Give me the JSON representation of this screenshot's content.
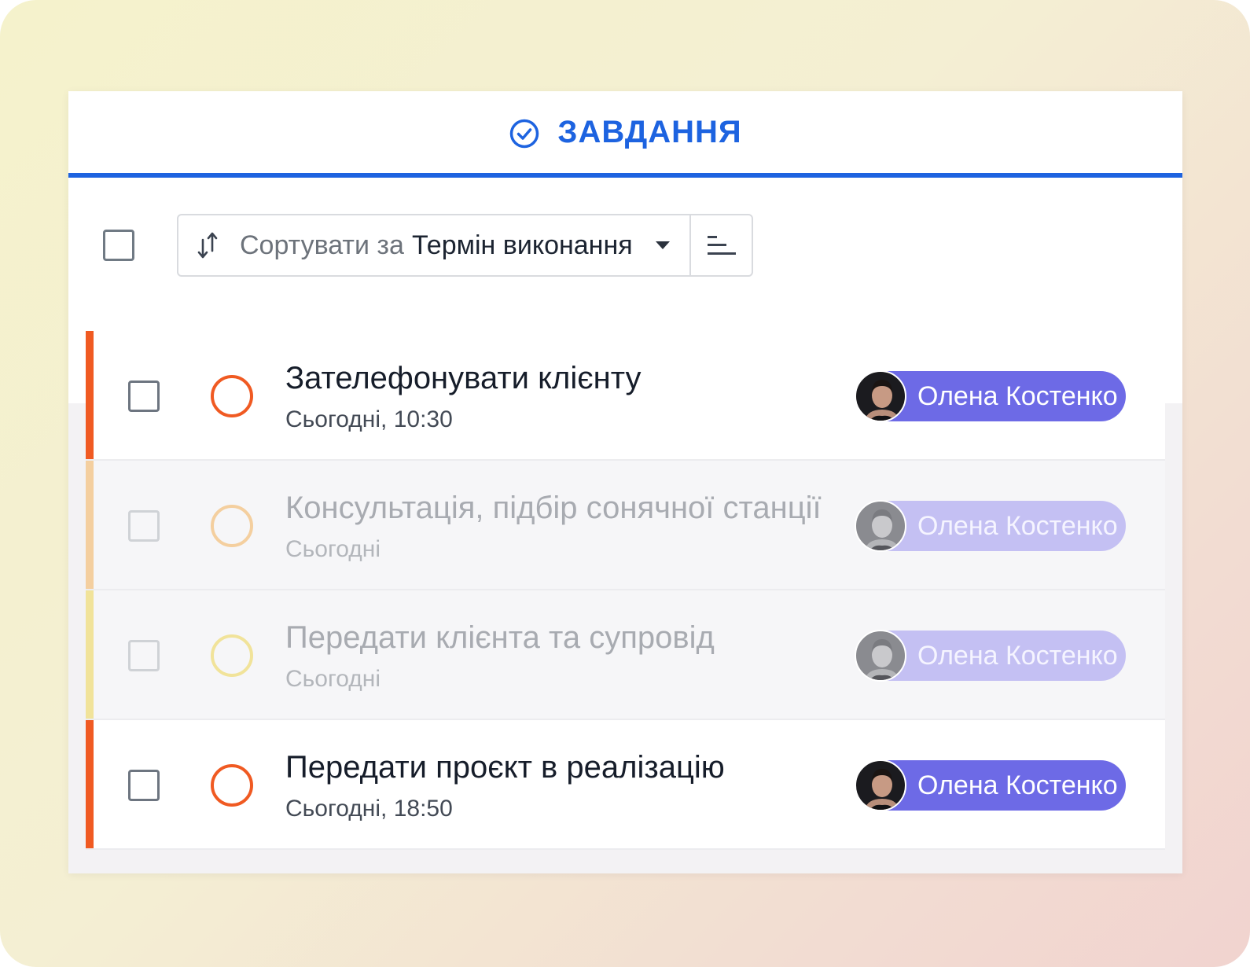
{
  "header": {
    "title": "ЗАВДАННЯ",
    "accent_color": "#1d63e0",
    "icon": "check-circle-icon"
  },
  "toolbar": {
    "sort_prefix": "Сортувати за",
    "sort_value": "Термін виконання",
    "sort_icon": "sort-arrows-icon",
    "dropdown_icon": "caret-down-icon",
    "order_icon": "sort-order-icon"
  },
  "tasks": [
    {
      "title": "Зателефонувати клієнту",
      "when": "Сьогодні, 10:30",
      "assignee": "Олена Костенко",
      "state": "active",
      "priority_color": "#f05a22"
    },
    {
      "title": "Консультація, підбір сонячної станції",
      "when": "Сьогодні",
      "assignee": "Олена Костенко",
      "state": "muted",
      "priority_color": "#f4cf9f"
    },
    {
      "title": "Передати клієнта та супровід",
      "when": "Сьогодні",
      "assignee": "Олена Костенко",
      "state": "muted",
      "priority_color": "#f1e39a"
    },
    {
      "title": "Передати проєкт в реалізацію",
      "when": "Сьогодні, 18:50",
      "assignee": "Олена Костенко",
      "state": "active",
      "priority_color": "#f05a22"
    }
  ]
}
